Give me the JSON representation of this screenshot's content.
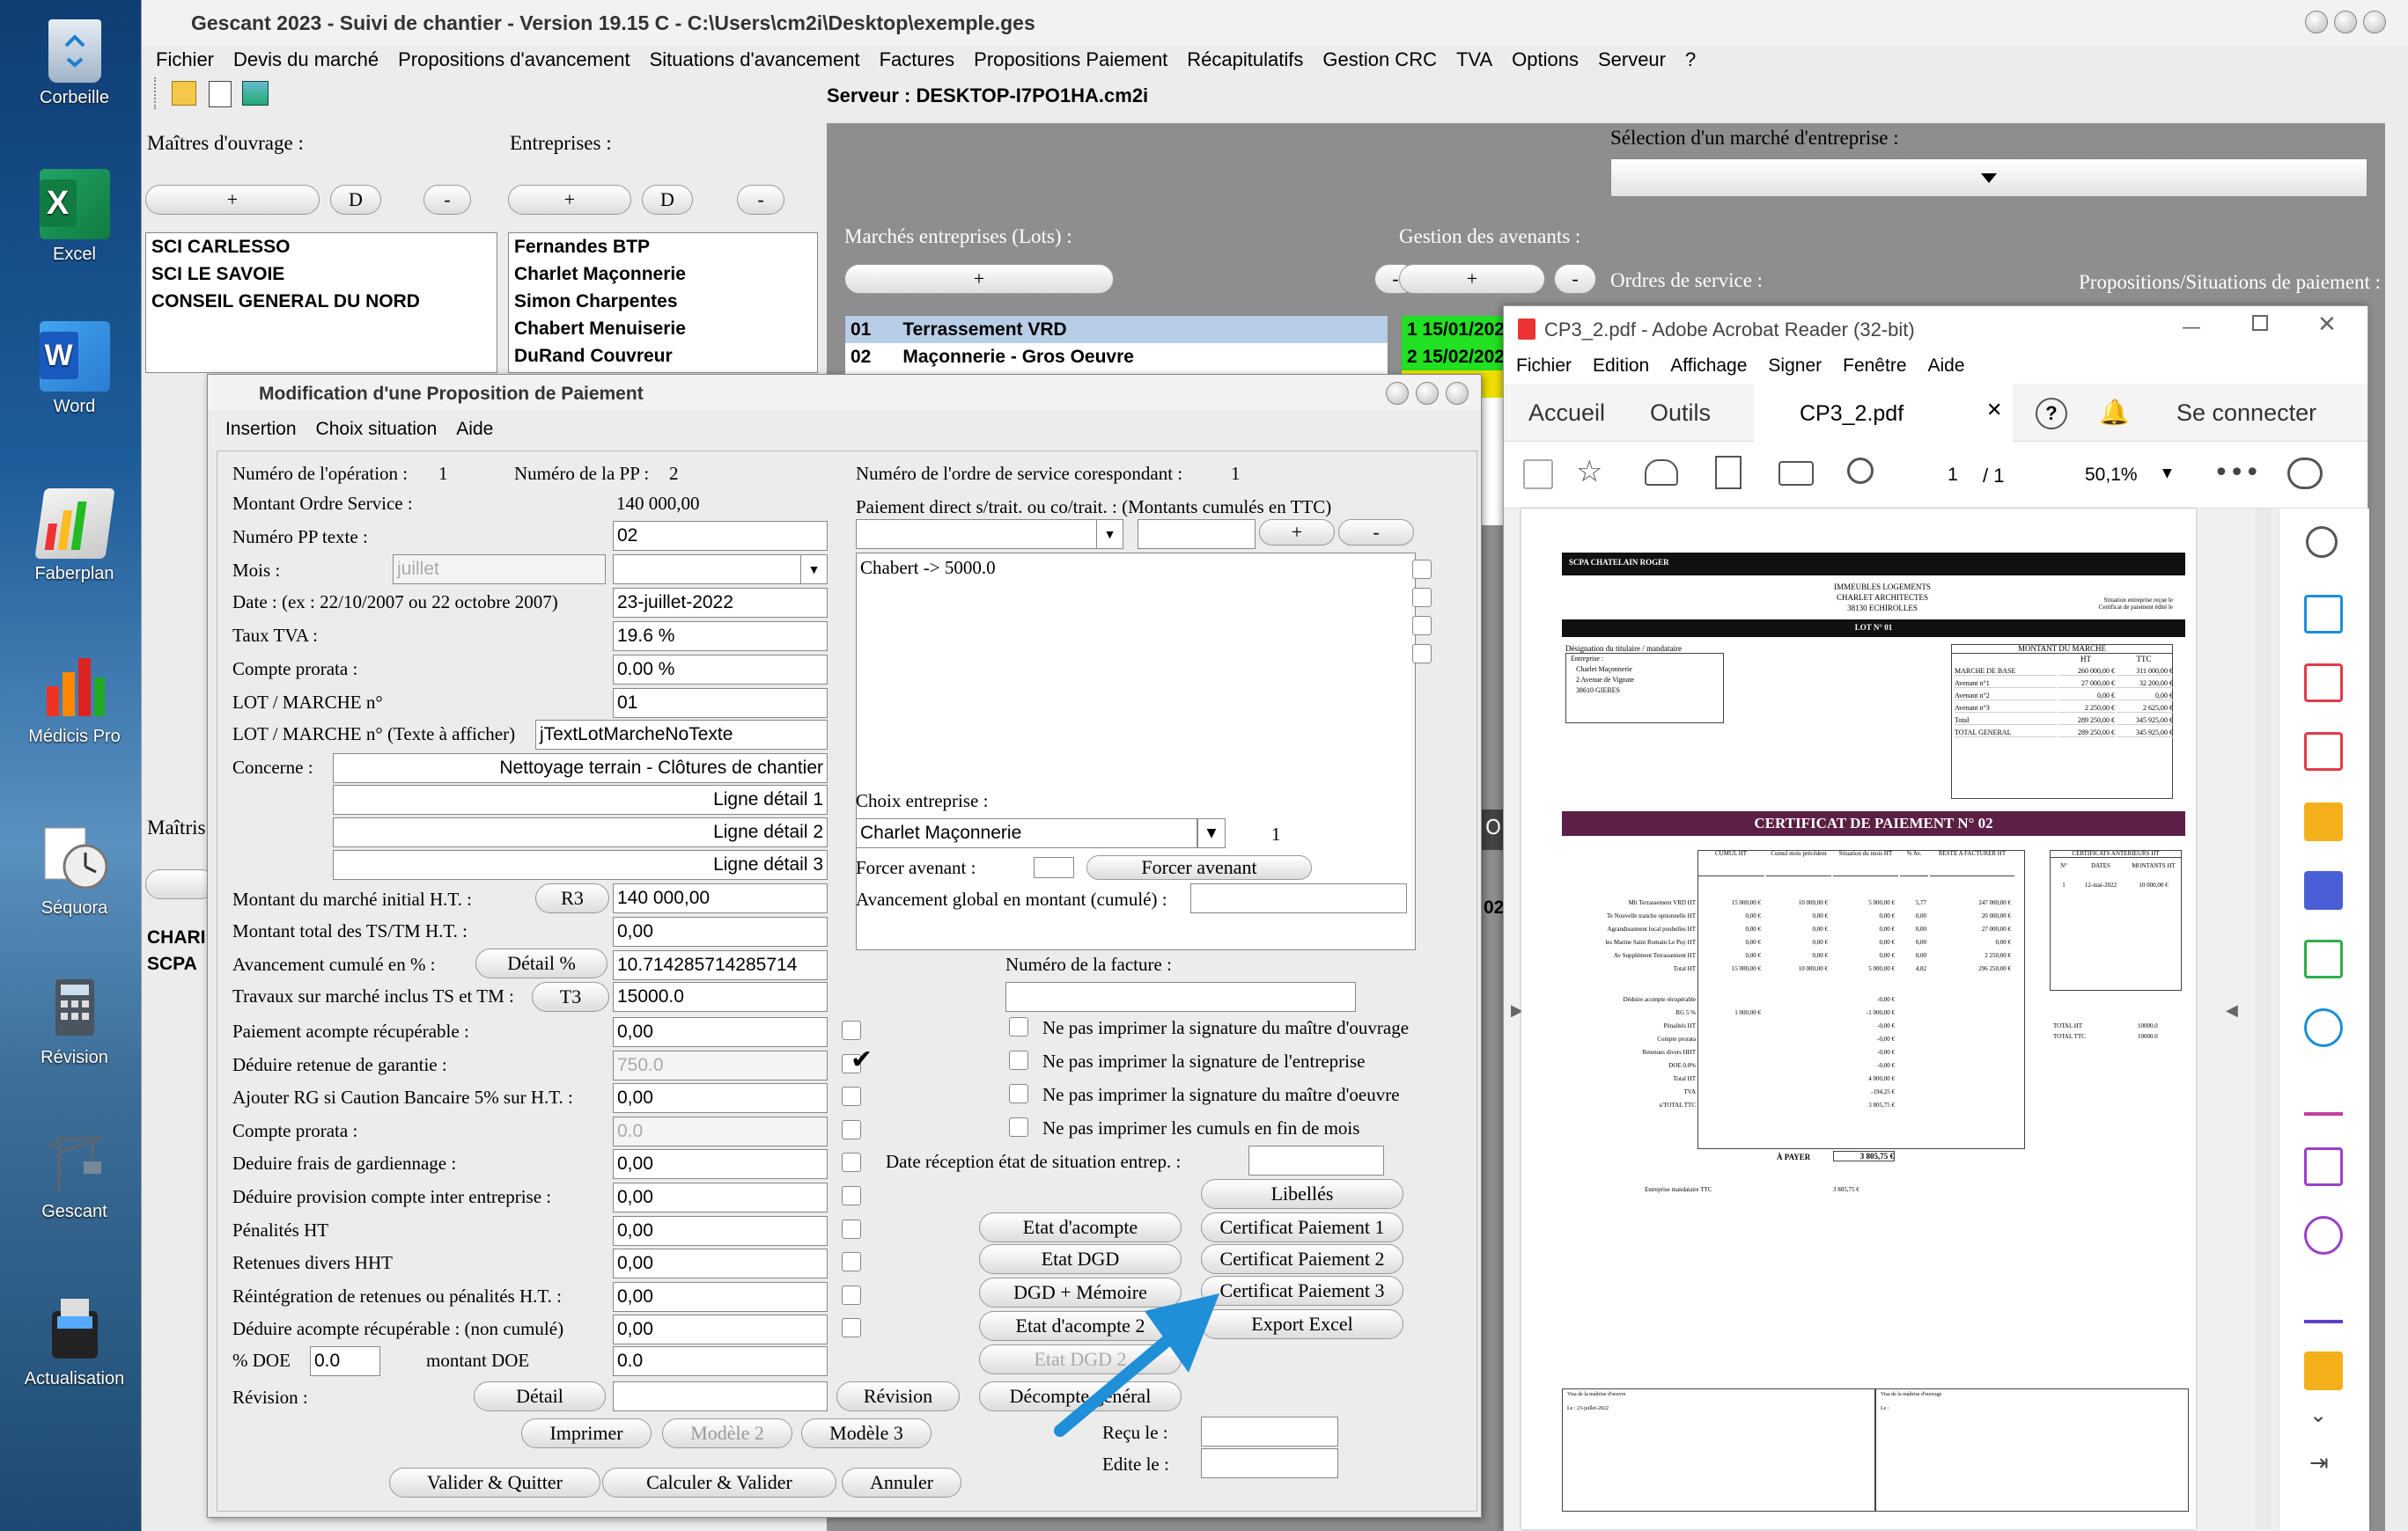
{
  "desktop": {
    "icons": [
      {
        "label": "Corbeille"
      },
      {
        "label": "Excel"
      },
      {
        "label": "Word"
      },
      {
        "label": "Faberplan"
      },
      {
        "label": "Médicis Pro"
      },
      {
        "label": "Séquora"
      },
      {
        "label": "Révision"
      },
      {
        "label": "Gescant"
      },
      {
        "label": "Actualisation"
      }
    ]
  },
  "main": {
    "title": "Gescant 2023 - Suivi de chantier - Version 19.15 C - C:\\Users\\cm2i\\Desktop\\exemple.ges",
    "menu": [
      "Fichier",
      "Devis du marché",
      "Propositions d'avancement",
      "Situations d'avancement",
      "Factures",
      "Propositions Paiement",
      "Récapitulatifs",
      "Gestion CRC",
      "TVA",
      "Options",
      "Serveur",
      "?"
    ],
    "server": "Serveur : DESKTOP-I7PO1HA.cm2i",
    "maitres_label": "Maîtres d'ouvrage :",
    "entreprises_label": "Entreprises :",
    "plus": "+",
    "d": "D",
    "minus": "-",
    "maitres": [
      "SCI CARLESSO",
      "SCI LE SAVOIE",
      "CONSEIL GENERAL DU NORD"
    ],
    "entreprises": [
      "Fernandes BTP",
      "Charlet Maçonnerie",
      "Simon Charpentes",
      "Chabert Menuiserie",
      "DuRand Couvreur"
    ],
    "selection_label": "Sélection d'un marché d'entreprise :",
    "marches_label": "Marchés entreprises (Lots) :",
    "avenants_label": "Gestion des avenants :",
    "ordres_label": "Ordres de service :",
    "propositions_label": "Propositions/Situations de paiement :",
    "lots": [
      {
        "num": "01",
        "name": "Terrassement VRD"
      },
      {
        "num": "02",
        "name": "Maçonnerie - Gros Oeuvre"
      }
    ],
    "os_items": [
      "1 15/01/202",
      "2 15/02/202",
      "02"
    ],
    "maitres2_label": "Maîtris",
    "partial_items": [
      "CHARI",
      "SCPA"
    ],
    "partial_o": "O",
    "partial_02": "02"
  },
  "dialog": {
    "title": "Modification d'une Proposition de Paiement",
    "menu": [
      "Insertion",
      "Choix situation",
      "Aide"
    ],
    "num_operation_label": "Numéro de l'opération :",
    "num_operation": "1",
    "num_pp_label": "Numéro de la PP :",
    "num_pp": "2",
    "num_os_label": "Numéro de l'ordre de service corespondant :",
    "num_os": "1",
    "montant_os_label": "Montant Ordre Service :",
    "montant_os": "140 000,00",
    "paiement_direct_label": "Paiement direct s/trait. ou co/trait. : (Montants cumulés en TTC)",
    "num_pp_texte_label": "Numéro PP texte :",
    "num_pp_texte": "02",
    "mois_label": "Mois :",
    "mois": "juillet",
    "date_label": "Date : (ex : 22/10/2007 ou 22 octobre 2007)",
    "date": "23-juillet-2022",
    "taux_tva_label": "Taux TVA :",
    "taux_tva": "19.6 %",
    "compte_prorata_label": "Compte prorata :",
    "compte_prorata": "0.00 %",
    "lot_label": "LOT / MARCHE n°",
    "lot": "01",
    "lot_texte_label": "LOT / MARCHE n° (Texte à afficher)",
    "lot_texte": "jTextLotMarcheNoTexte",
    "concerne_label": "Concerne :",
    "concerne": "Nettoyage terrain - Clôtures de chantier",
    "lignes": [
      "Ligne détail 1",
      "Ligne détail 2",
      "Ligne détail 3"
    ],
    "paiement_item": "Chabert -> 5000.0",
    "choix_entreprise_label": "Choix entreprise :",
    "choix_entreprise": "Charlet Maçonnerie",
    "choix_entreprise_num": "1",
    "forcer_avenant_label": "Forcer avenant :",
    "forcer_avenant_btn": "Forcer avenant",
    "avancement_global_label": "Avancement global en montant (cumulé) :",
    "montant_initial_label": "Montant du marché initial H.T. :",
    "r3": "R3",
    "montant_initial": "140 000,00",
    "montant_ts_label": "Montant total des TS/TM H.T. :",
    "montant_ts": "0,00",
    "avancement_cumule_label": "Avancement cumulé en % :",
    "detail_pct": "Détail %",
    "avancement_cumule": "10.714285714285714",
    "travaux_label": "Travaux sur marché inclus TS et TM :",
    "t3": "T3",
    "travaux": "15000.0",
    "num_facture_label": "Numéro de la facture :",
    "rows": [
      {
        "label": "Paiement acompte récupérable :",
        "value": "0,00",
        "dis": false
      },
      {
        "label": "Déduire retenue de garantie :",
        "value": "750.0",
        "dis": true
      },
      {
        "label": "Ajouter RG si Caution Bancaire 5% sur H.T. :",
        "value": "0,00",
        "dis": false
      },
      {
        "label": "Compte prorata :",
        "value": "0.0",
        "dis": true
      },
      {
        "label": "Deduire frais de gardiennage :",
        "value": "0,00",
        "dis": false
      },
      {
        "label": "Déduire provision compte inter entreprise :",
        "value": "0,00",
        "dis": false
      },
      {
        "label": "Pénalités HT",
        "value": "0,00",
        "dis": false
      },
      {
        "label": "Retenues divers HHT",
        "value": "0,00",
        "dis": false
      },
      {
        "label": "Réintégration de retenues ou pénalités H.T. :",
        "value": "0,00",
        "dis": false
      },
      {
        "label": "Déduire acompte récupérable : (non cumulé)",
        "value": "0,00",
        "dis": false
      }
    ],
    "options": [
      "Ne pas imprimer la signature du maître d'ouvrage",
      "Ne pas imprimer la signature de l'entreprise",
      "Ne pas imprimer la signature du maître d'oeuvre",
      "Ne pas imprimer les cumuls en fin de mois"
    ],
    "date_reception_label": "Date réception état de situation entrep. :",
    "btn_libelles": "Libellés",
    "btn_etat_acompte": "Etat d'acompte",
    "btn_cert1": "Certificat Paiement 1",
    "btn_etat_dgd": "Etat DGD",
    "btn_cert2": "Certificat Paiement 2",
    "btn_dgd_memoire": "DGD + Mémoire",
    "btn_cert3": "Certificat Paiement 3",
    "btn_etat_acompte2": "Etat d'acompte 2",
    "btn_export": "Export Excel",
    "btn_etat_dgd2": "Etat DGD 2",
    "doe_label": "% DOE",
    "doe": "0.0",
    "montant_doe_label": "montant DOE",
    "montant_doe": "0.0",
    "revision_label": "Révision :",
    "btn_detail": "Détail",
    "btn_revision": "Révision",
    "btn_decompte": "Décompte général",
    "btn_imprimer": "Imprimer",
    "btn_modele2": "Modèle 2",
    "btn_modele3": "Modèle 3",
    "recu_label": "Reçu le :",
    "edite_label": "Edite le :",
    "btn_valider": "Valider & Quitter",
    "btn_calculer": "Calculer & Valider",
    "btn_annuler": "Annuler"
  },
  "acrobat": {
    "title": "CP3_2.pdf - Adobe Acrobat Reader (32-bit)",
    "menu": [
      "Fichier",
      "Edition",
      "Affichage",
      "Signer",
      "Fenêtre",
      "Aide"
    ],
    "tabs": [
      "Accueil",
      "Outils"
    ],
    "doc_tab": "CP3_2.pdf",
    "connect": "Se connecter",
    "page": "1",
    "pages": "/ 1",
    "zoom": "50,1%",
    "pdf": {
      "header": "SCPA CHATELAIN ROGER",
      "addr": [
        "IMMEUBLES LOGEMENTS",
        "CHARLET ARCHITECTES",
        "38130 ECHIROLLES"
      ],
      "sit": "Situation entreprise reçue le",
      "cert_edite": "Certificat de paiement édité le",
      "lot": "LOT N° 01",
      "designation": "Désignation du titulaire / mandataire",
      "entreprise": [
        "Entreprise :",
        "Charlet Maçonnerie",
        "2 Avenue de Vignate",
        "38610 GIERES"
      ],
      "montant_title": "MONTANT DU MARCHE",
      "mt_header": [
        "",
        "HT",
        "TTC"
      ],
      "mt_rows": [
        [
          "MARCHE DE BASE",
          "260 000,00 €",
          "311 000,00 €"
        ],
        [
          "Avenant n°1",
          "27 000,00 €",
          "32 200,00 €"
        ],
        [
          "Avenant n°2",
          "0,00 €",
          "0,00 €"
        ],
        [
          "Avenant n°3",
          "2 250,00 €",
          "2 625,00 €"
        ],
        [
          "Total",
          "289 250,00 €",
          "345 925,00 €"
        ],
        [
          "TOTAL GENERAL",
          "289 250,00 €",
          "345 925,00 €"
        ]
      ],
      "cert_title": "CERTIFICAT DE PAIEMENT N° 02",
      "cols": [
        "CUMUL HT",
        "Cumul mois précédent",
        "Situation du mois HT",
        "% Av.",
        "RESTE A FACTURER HT"
      ],
      "items": [
        [
          "Mlt Terrassement VRD HT",
          "15 000,00 €",
          "10 000,00 €",
          "5 000,00 €",
          "5,77",
          "247 000,00 €"
        ],
        [
          "Te Nouvelle tranche optionnelle HT",
          "0,00 €",
          "0,00 €",
          "0,00 €",
          "0,00",
          "20 000,00 €"
        ],
        [
          "Agrandissement local poubelles HT",
          "0,00 €",
          "0,00 €",
          "0,00 €",
          "0,00",
          "27 000,00 €"
        ],
        [
          "les Marine Saint Romain Le Puy HT",
          "0,00 €",
          "0,00 €",
          "0,00 €",
          "0,00",
          "0,00 €"
        ],
        [
          "Av Supplément Terrassement HT",
          "0,00 €",
          "0,00 €",
          "0,00 €",
          "0,00",
          "2 250,00 €"
        ],
        [
          "Total HT",
          "15 000,00 €",
          "10 000,00 €",
          "5 000,00 €",
          "4,82",
          "296 250,00 €"
        ]
      ],
      "deductions": [
        [
          "Déduire acompte récupérable",
          "",
          "-0,00 €"
        ],
        [
          "RG 5 %",
          "1 000,00 €",
          "-1 000,00 €"
        ],
        [
          "Pénalités HT",
          "",
          "-0,00 €"
        ],
        [
          "Compte prorata",
          "",
          "-0,00 €"
        ],
        [
          "Retenues divers HHT",
          "",
          "-0,00 €"
        ],
        [
          "DOE 0.0%",
          "",
          "-0,00 €"
        ],
        [
          "Total HT",
          "",
          "4 000,00 €"
        ],
        [
          "TVA",
          "",
          "-194,25 €"
        ],
        [
          "s/TOTAL TTC",
          "",
          "3 805,75 €"
        ]
      ],
      "a_payer": "À PAYER",
      "a_payer_val": "3 805,75 €",
      "mandataire": "Entreprise mandataire TTC",
      "mandataire_val": "3 805,75 €",
      "ant_title": "CERTIFICATS ANTERIEURS HT",
      "ant_cols": [
        "N°",
        "DATES",
        "MONTANTS HT"
      ],
      "ant_row": [
        "1",
        "12-mai-2022",
        "10 000,00 €"
      ],
      "total_ht": "TOTAL HT",
      "total_ht_val": "10000.0",
      "total_ttc": "TOTAL TTC",
      "total_ttc_val": "10000.0",
      "visa1": "Visa de la maîtrise d'oeuvre",
      "visa1_date": "Le : 23-juillet-2022",
      "visa2": "Visa de la maîtrise d'ouvrage",
      "visa2_date": "Le :"
    }
  },
  "colors": {
    "accent_blue": "#1f8fd8",
    "lot_band": "#5c1f45",
    "os_green": "#22e022",
    "os_yellow": "#f0e000",
    "selection_bg": "#b8cde6"
  }
}
